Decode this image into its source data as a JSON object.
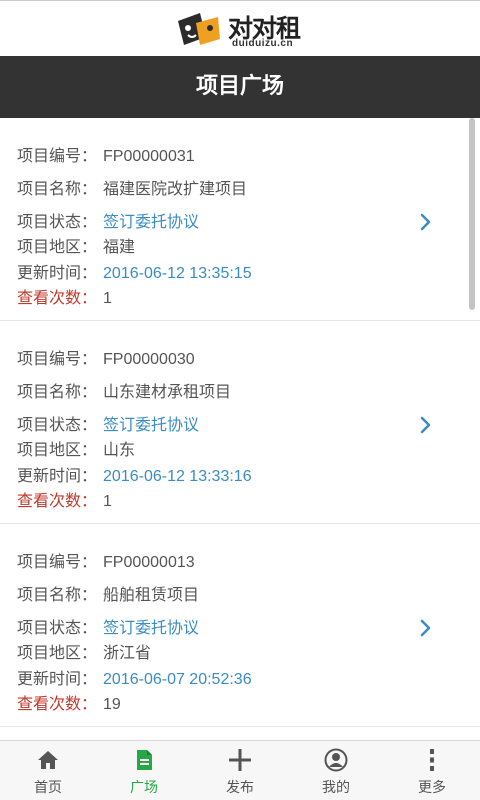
{
  "brand": {
    "name_cn": "对对租",
    "name_en": "duiduizu.cn"
  },
  "header": {
    "title": "项目广场"
  },
  "labels": {
    "project_no": "项目编号：",
    "project_name": "项目名称：",
    "project_status": "项目状态：",
    "project_region": "项目地区：",
    "updated_at": "更新时间：",
    "view_count": "查看次数："
  },
  "projects": [
    {
      "no": "FP00000031",
      "name": "福建医院改扩建项目",
      "status": "签订委托协议",
      "region": "福建",
      "updated": "2016-06-12 13:35:15",
      "views": "1"
    },
    {
      "no": "FP00000030",
      "name": "山东建材承租项目",
      "status": "签订委托协议",
      "region": "山东",
      "updated": "2016-06-12 13:33:16",
      "views": "1"
    },
    {
      "no": "FP00000013",
      "name": "船舶租赁项目",
      "status": "签订委托协议",
      "region": "浙江省",
      "updated": "2016-06-07 20:52:36",
      "views": "19"
    }
  ],
  "tabs": [
    {
      "label": "首页",
      "icon": "home-icon"
    },
    {
      "label": "广场",
      "icon": "document-icon",
      "active": true
    },
    {
      "label": "发布",
      "icon": "plus-icon"
    },
    {
      "label": "我的",
      "icon": "user-icon"
    },
    {
      "label": "更多",
      "icon": "more-icon"
    }
  ],
  "colors": {
    "header_bg": "#333333",
    "link_blue": "#3a8cc4",
    "label_red": "#c0392b",
    "tab_active": "#28a745"
  }
}
